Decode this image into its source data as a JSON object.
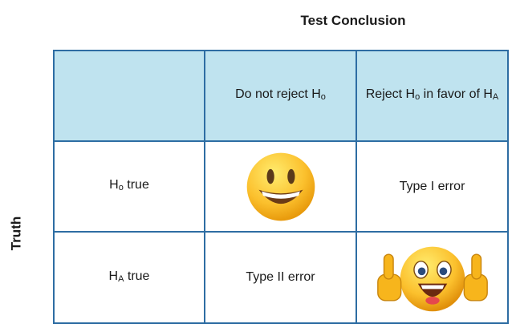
{
  "column_title": "Test Conclusion",
  "row_title": "Truth",
  "header": {
    "do_not_reject": {
      "text": "Do not reject H",
      "sub": "o"
    },
    "reject": {
      "text": "Reject H",
      "sub": "o",
      "text2": " in favor of H",
      "sub2": "A"
    }
  },
  "rows": [
    {
      "label": "H",
      "label_sub": "o",
      "label_rest": " true",
      "cell_reject": "Type I error"
    },
    {
      "label": "H",
      "label_sub": "A",
      "label_rest": " true",
      "cell_do_not_reject": "Type II error"
    }
  ],
  "icons": {
    "smiley": "smiling-face-icon",
    "thumbs_up": "thumbs-up-smiley-icon"
  },
  "colors": {
    "header_fill": "#bfe3ef",
    "grid_line": "#2e6da3"
  }
}
